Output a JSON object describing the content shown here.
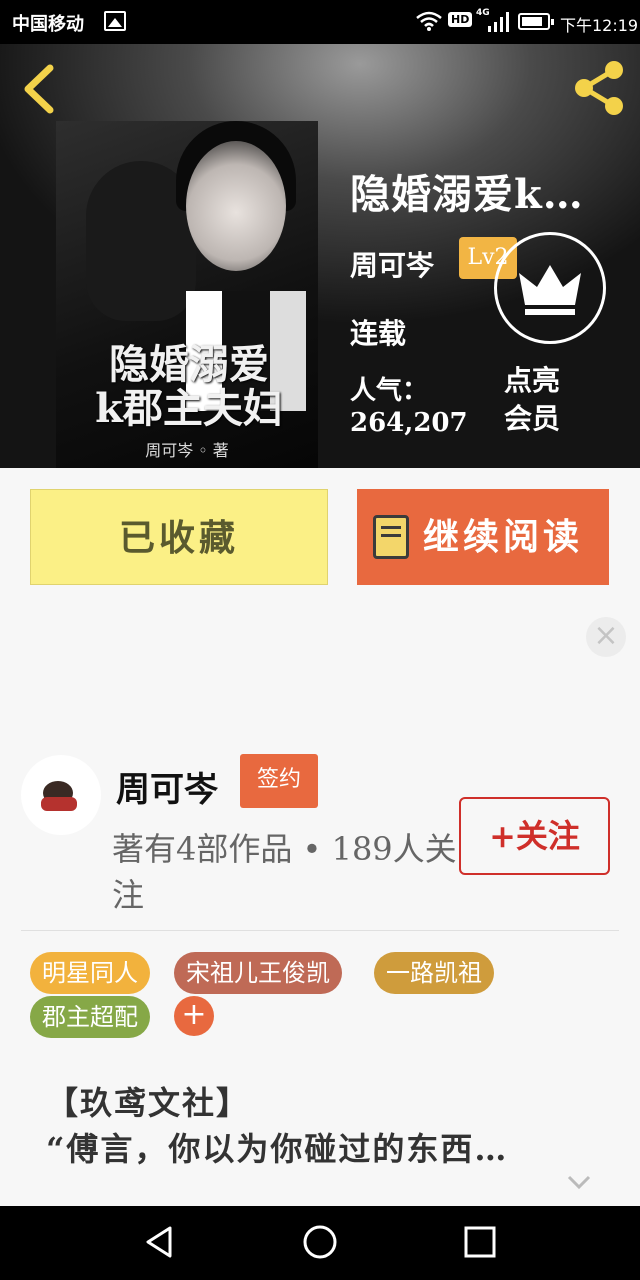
{
  "status_bar": {
    "carrier": "中国移动",
    "network": "4G",
    "hd": "HD",
    "time": "下午12:19"
  },
  "book": {
    "title": "隐婚溺爱k…",
    "cover_title": "隐婚溺爱\nk郡主夫妇",
    "cover_author": "周可岑 ◦ 著",
    "author": "周可岑",
    "level": "Lv2",
    "status": "连载",
    "popularity_label": "人气：",
    "popularity_value": "264,207",
    "vip_text": "点亮\n会员"
  },
  "actions": {
    "collected_label": "已收藏",
    "read_label": "继续阅读"
  },
  "author_section": {
    "name": "周可岑",
    "badge": "签约",
    "works": "著有4部作品 • 189人关注",
    "follow_label": "+关注"
  },
  "tags": [
    {
      "label": "明星同人",
      "color": "#f2b23d"
    },
    {
      "label": "宋祖儿王俊凯",
      "color": "#bf6a56"
    },
    {
      "label": "一路凯祖",
      "color": "#cf9c3c"
    },
    {
      "label": "郡主超配",
      "color": "#86a847"
    }
  ],
  "description": {
    "line1": "【玖鸢文社】",
    "line2": "“傅言，你以为你碰过的东西…"
  },
  "colors": {
    "accent": "#e8693f",
    "collected_bg": "#fbf086",
    "follow_red": "#cf2f2a",
    "level_badge": "#f2b544"
  }
}
